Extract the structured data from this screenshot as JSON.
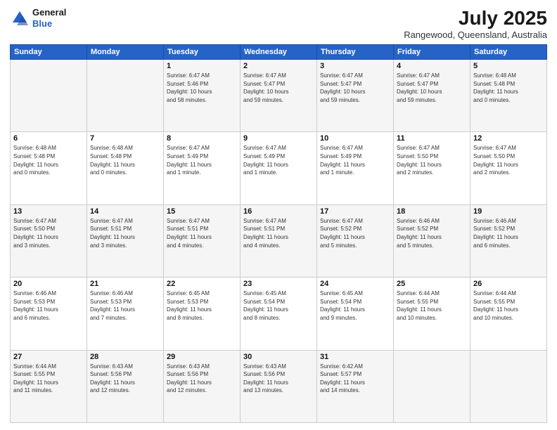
{
  "header": {
    "logo_line1": "General",
    "logo_line2": "Blue",
    "month": "July 2025",
    "location": "Rangewood, Queensland, Australia"
  },
  "columns": [
    "Sunday",
    "Monday",
    "Tuesday",
    "Wednesday",
    "Thursday",
    "Friday",
    "Saturday"
  ],
  "weeks": [
    [
      {
        "day": "",
        "info": ""
      },
      {
        "day": "",
        "info": ""
      },
      {
        "day": "1",
        "info": "Sunrise: 6:47 AM\nSunset: 5:46 PM\nDaylight: 10 hours\nand 58 minutes."
      },
      {
        "day": "2",
        "info": "Sunrise: 6:47 AM\nSunset: 5:47 PM\nDaylight: 10 hours\nand 59 minutes."
      },
      {
        "day": "3",
        "info": "Sunrise: 6:47 AM\nSunset: 5:47 PM\nDaylight: 10 hours\nand 59 minutes."
      },
      {
        "day": "4",
        "info": "Sunrise: 6:47 AM\nSunset: 5:47 PM\nDaylight: 10 hours\nand 59 minutes."
      },
      {
        "day": "5",
        "info": "Sunrise: 6:48 AM\nSunset: 5:48 PM\nDaylight: 11 hours\nand 0 minutes."
      }
    ],
    [
      {
        "day": "6",
        "info": "Sunrise: 6:48 AM\nSunset: 5:48 PM\nDaylight: 11 hours\nand 0 minutes."
      },
      {
        "day": "7",
        "info": "Sunrise: 6:48 AM\nSunset: 5:48 PM\nDaylight: 11 hours\nand 0 minutes."
      },
      {
        "day": "8",
        "info": "Sunrise: 6:47 AM\nSunset: 5:49 PM\nDaylight: 11 hours\nand 1 minute."
      },
      {
        "day": "9",
        "info": "Sunrise: 6:47 AM\nSunset: 5:49 PM\nDaylight: 11 hours\nand 1 minute."
      },
      {
        "day": "10",
        "info": "Sunrise: 6:47 AM\nSunset: 5:49 PM\nDaylight: 11 hours\nand 1 minute."
      },
      {
        "day": "11",
        "info": "Sunrise: 6:47 AM\nSunset: 5:50 PM\nDaylight: 11 hours\nand 2 minutes."
      },
      {
        "day": "12",
        "info": "Sunrise: 6:47 AM\nSunset: 5:50 PM\nDaylight: 11 hours\nand 2 minutes."
      }
    ],
    [
      {
        "day": "13",
        "info": "Sunrise: 6:47 AM\nSunset: 5:50 PM\nDaylight: 11 hours\nand 3 minutes."
      },
      {
        "day": "14",
        "info": "Sunrise: 6:47 AM\nSunset: 5:51 PM\nDaylight: 11 hours\nand 3 minutes."
      },
      {
        "day": "15",
        "info": "Sunrise: 6:47 AM\nSunset: 5:51 PM\nDaylight: 11 hours\nand 4 minutes."
      },
      {
        "day": "16",
        "info": "Sunrise: 6:47 AM\nSunset: 5:51 PM\nDaylight: 11 hours\nand 4 minutes."
      },
      {
        "day": "17",
        "info": "Sunrise: 6:47 AM\nSunset: 5:52 PM\nDaylight: 11 hours\nand 5 minutes."
      },
      {
        "day": "18",
        "info": "Sunrise: 6:46 AM\nSunset: 5:52 PM\nDaylight: 11 hours\nand 5 minutes."
      },
      {
        "day": "19",
        "info": "Sunrise: 6:46 AM\nSunset: 5:52 PM\nDaylight: 11 hours\nand 6 minutes."
      }
    ],
    [
      {
        "day": "20",
        "info": "Sunrise: 6:46 AM\nSunset: 5:53 PM\nDaylight: 11 hours\nand 6 minutes."
      },
      {
        "day": "21",
        "info": "Sunrise: 6:46 AM\nSunset: 5:53 PM\nDaylight: 11 hours\nand 7 minutes."
      },
      {
        "day": "22",
        "info": "Sunrise: 6:45 AM\nSunset: 5:53 PM\nDaylight: 11 hours\nand 8 minutes."
      },
      {
        "day": "23",
        "info": "Sunrise: 6:45 AM\nSunset: 5:54 PM\nDaylight: 11 hours\nand 8 minutes."
      },
      {
        "day": "24",
        "info": "Sunrise: 6:45 AM\nSunset: 5:54 PM\nDaylight: 11 hours\nand 9 minutes."
      },
      {
        "day": "25",
        "info": "Sunrise: 6:44 AM\nSunset: 5:55 PM\nDaylight: 11 hours\nand 10 minutes."
      },
      {
        "day": "26",
        "info": "Sunrise: 6:44 AM\nSunset: 5:55 PM\nDaylight: 11 hours\nand 10 minutes."
      }
    ],
    [
      {
        "day": "27",
        "info": "Sunrise: 6:44 AM\nSunset: 5:55 PM\nDaylight: 11 hours\nand 11 minutes."
      },
      {
        "day": "28",
        "info": "Sunrise: 6:43 AM\nSunset: 5:56 PM\nDaylight: 11 hours\nand 12 minutes."
      },
      {
        "day": "29",
        "info": "Sunrise: 6:43 AM\nSunset: 5:56 PM\nDaylight: 11 hours\nand 12 minutes."
      },
      {
        "day": "30",
        "info": "Sunrise: 6:43 AM\nSunset: 5:56 PM\nDaylight: 11 hours\nand 13 minutes."
      },
      {
        "day": "31",
        "info": "Sunrise: 6:42 AM\nSunset: 5:57 PM\nDaylight: 11 hours\nand 14 minutes."
      },
      {
        "day": "",
        "info": ""
      },
      {
        "day": "",
        "info": ""
      }
    ]
  ]
}
